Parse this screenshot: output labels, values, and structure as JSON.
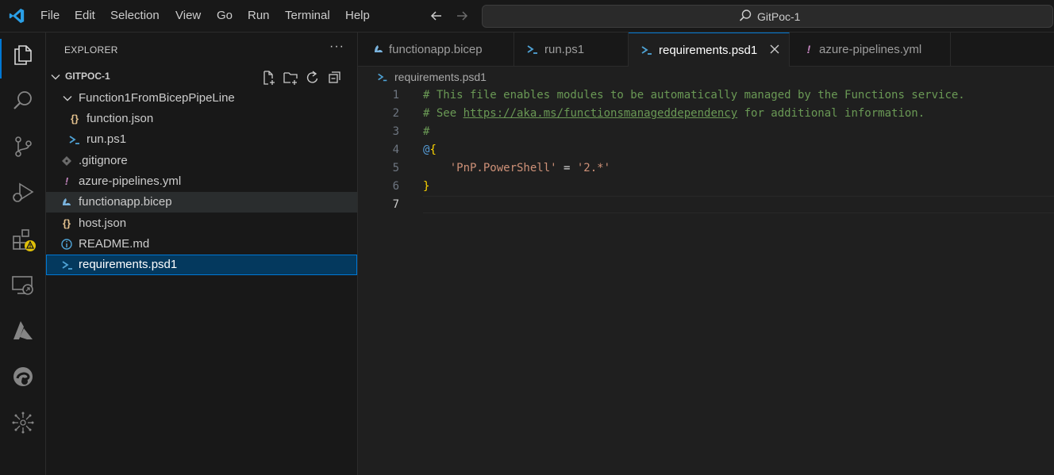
{
  "menu": [
    "File",
    "Edit",
    "Selection",
    "View",
    "Go",
    "Run",
    "Terminal",
    "Help"
  ],
  "command_center": {
    "text": "GitPoc-1"
  },
  "sidebar": {
    "title": "EXPLORER",
    "more": "···",
    "workspace": "GITPOC-1",
    "tree": [
      {
        "label": "Function1FromBicepPipeLine",
        "icon": "chevron-down-icon"
      },
      {
        "label": "function.json",
        "icon": "json-file-icon"
      },
      {
        "label": "run.ps1",
        "icon": "powershell-file-icon"
      },
      {
        "label": ".gitignore",
        "icon": "git-file-icon"
      },
      {
        "label": "azure-pipelines.yml",
        "icon": "yaml-file-icon"
      },
      {
        "label": "functionapp.bicep",
        "icon": "bicep-file-icon"
      },
      {
        "label": "host.json",
        "icon": "json-file-icon"
      },
      {
        "label": "README.md",
        "icon": "info-file-icon"
      },
      {
        "label": "requirements.psd1",
        "icon": "powershell-file-icon"
      }
    ]
  },
  "tabs": [
    {
      "label": "functionapp.bicep",
      "icon": "bicep-file-icon"
    },
    {
      "label": "run.ps1",
      "icon": "powershell-file-icon"
    },
    {
      "label": "requirements.psd1",
      "icon": "powershell-file-icon",
      "active": true
    },
    {
      "label": "azure-pipelines.yml",
      "icon": "yaml-file-icon"
    }
  ],
  "editor": {
    "breadcrumb": "requirements.psd1",
    "current_line": 7,
    "lines": [
      {
        "n": "1",
        "parts": [
          [
            "cmt",
            "# This file enables modules to be automatically managed by the Functions service."
          ]
        ]
      },
      {
        "n": "2",
        "parts": [
          [
            "cmt",
            "# See "
          ],
          [
            "cmt link",
            "https://aka.ms/functionsmanageddependency"
          ],
          [
            "cmt",
            " for additional information."
          ]
        ]
      },
      {
        "n": "3",
        "parts": [
          [
            "cmt",
            "#"
          ]
        ]
      },
      {
        "n": "4",
        "parts": [
          [
            "at",
            "@"
          ],
          [
            "brace",
            "{"
          ]
        ]
      },
      {
        "n": "5",
        "parts": [
          [
            "op",
            "    "
          ],
          [
            "str",
            "'PnP.PowerShell'"
          ],
          [
            "op",
            " = "
          ],
          [
            "str",
            "'2.*'"
          ]
        ]
      },
      {
        "n": "6",
        "parts": [
          [
            "brace",
            "}"
          ]
        ]
      },
      {
        "n": "7",
        "parts": []
      }
    ]
  },
  "colors": {
    "accent": "#0078d4",
    "powershell": "#4fa3d6",
    "json": "#e2c08d",
    "yaml": "#c586c0",
    "bicep": "#7ab4de",
    "warning": "#e0c008"
  }
}
